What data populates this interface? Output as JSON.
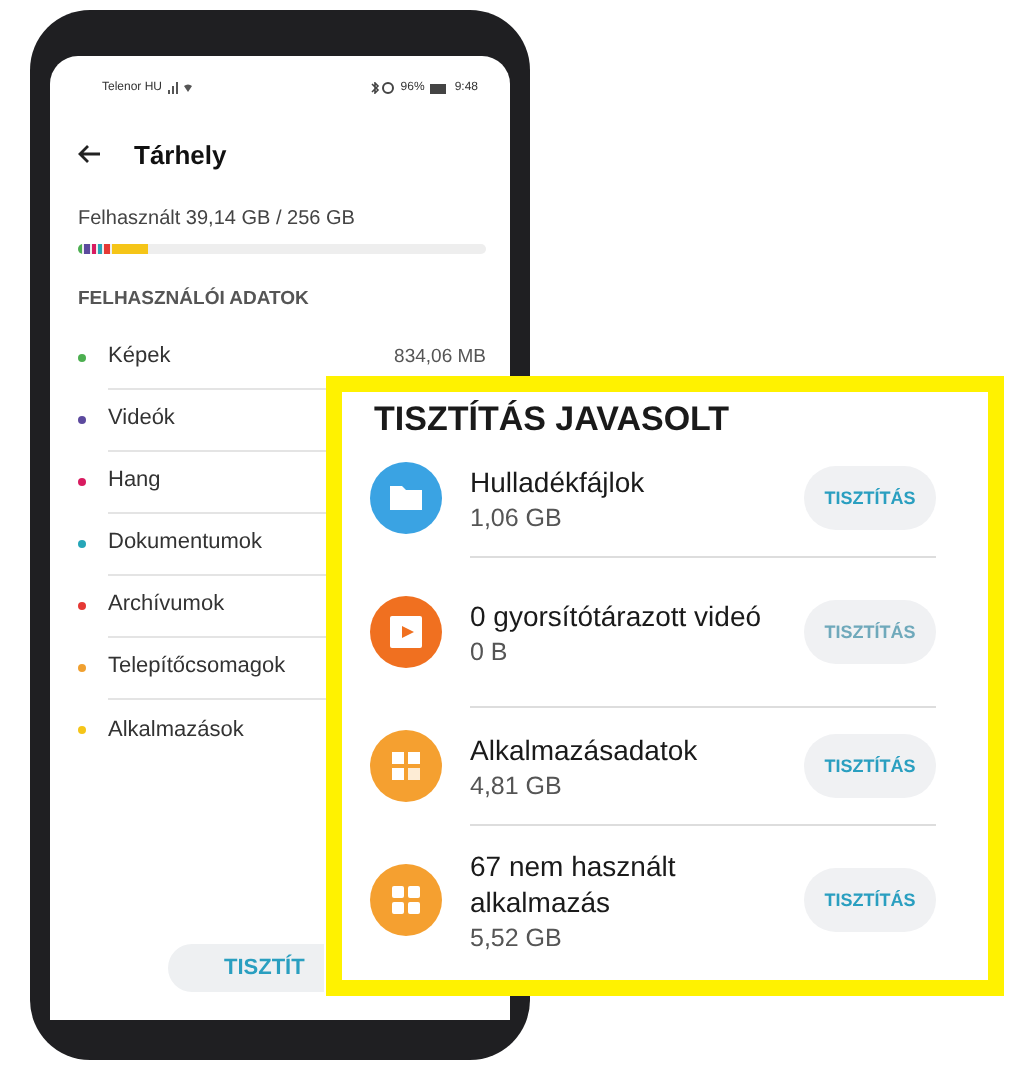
{
  "status_bar": {
    "carrier": "Telenor HU",
    "battery": "96%",
    "time": "9:48"
  },
  "header": {
    "title": "Tárhely"
  },
  "storage": {
    "used": "Felhasznált 39,14 GB / 256 GB",
    "segments": [
      {
        "color": "#4caf50",
        "level": 0.012
      },
      {
        "color": "#5c4a9e",
        "level": 0.012
      },
      {
        "color": "#d81b60",
        "level": 0.012
      },
      {
        "color": "#26a6b8",
        "level": 0.01
      },
      {
        "color": "#e53935",
        "level": 0.012
      },
      {
        "color": "#f5c518",
        "level": 0.09
      }
    ]
  },
  "section_title": "FELHASZNÁLÓI ADATOK",
  "categories": [
    {
      "name": "Képek",
      "color": "#4caf50",
      "size": "834,06 MB"
    },
    {
      "name": "Videók",
      "color": "#5c4a9e"
    },
    {
      "name": "Hang",
      "color": "#d81b60"
    },
    {
      "name": "Dokumentumok",
      "color": "#26a6b8"
    },
    {
      "name": "Archívumok",
      "color": "#e53935"
    },
    {
      "name": "Telepítőcsomagok",
      "color": "#f0a030"
    },
    {
      "name": "Alkalmazások",
      "color": "#f5c518"
    }
  ],
  "bottom_button": "TISZTÍT",
  "callout": {
    "title": "TISZTÍTÁS JAVASOLT",
    "items": [
      {
        "kind": "folder",
        "name": "Hulladékfájlok",
        "size": "1,06 GB",
        "button": "TISZTÍTÁS",
        "disabled": false
      },
      {
        "kind": "video",
        "name": "0 gyorsítótárazott videó",
        "size": "0 B",
        "button": "TISZTÍTÁS",
        "disabled": true
      },
      {
        "kind": "appdata",
        "name": "Alkalmazásadatok",
        "size": "4,81 GB",
        "button": "TISZTÍTÁS",
        "disabled": false
      },
      {
        "kind": "apps",
        "name": "67 nem használt alkalmazás",
        "size": "5,52 GB",
        "button": "TISZTÍTÁS",
        "disabled": false
      }
    ]
  }
}
